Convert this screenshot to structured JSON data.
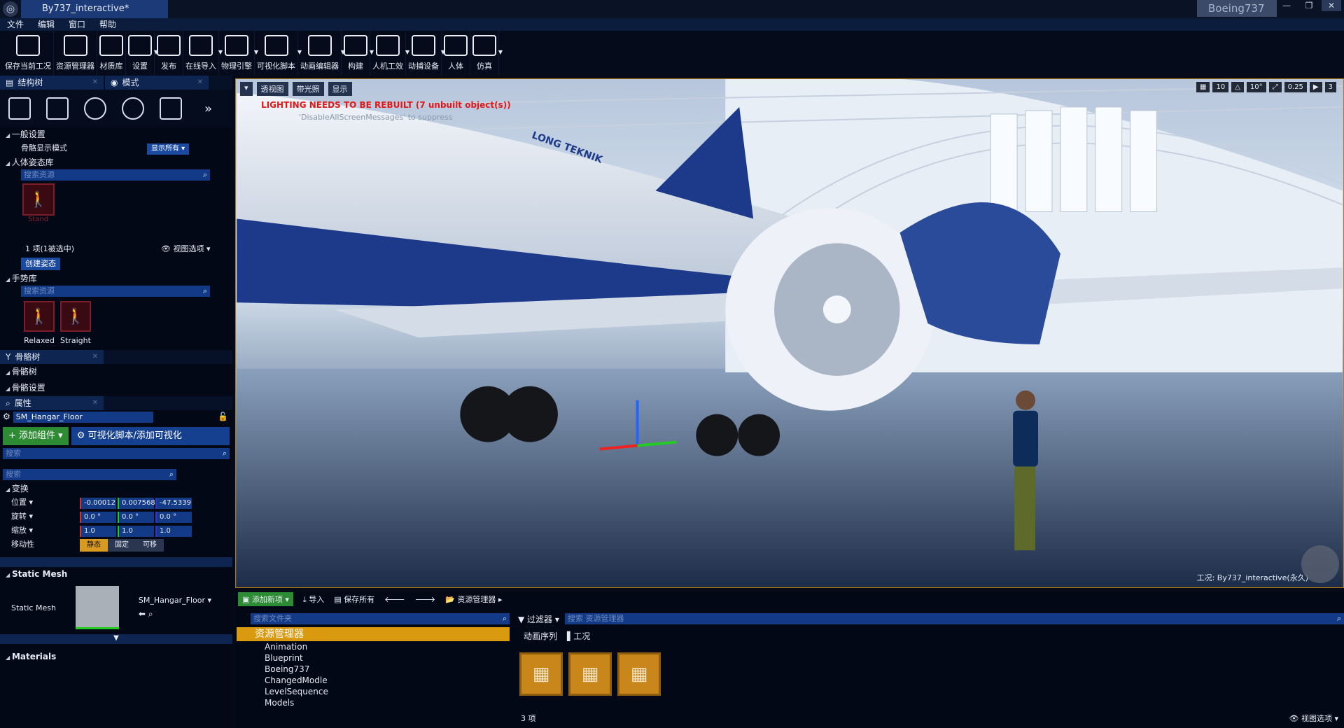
{
  "title": {
    "doc_tab": "By737_interactive*",
    "project": "Boeing737",
    "app_icon": "ue-logo-icon"
  },
  "menu": [
    "文件",
    "编辑",
    "窗口",
    "帮助"
  ],
  "toolbar": [
    {
      "label": "保存当前工况",
      "icon": "save-icon"
    },
    {
      "label": "资源管理器",
      "icon": "content-browser-icon"
    },
    {
      "label": "材质库",
      "icon": "palette-icon"
    },
    {
      "label": "设置",
      "icon": "gear-icon"
    },
    {
      "label": "发布",
      "icon": "package-icon"
    },
    {
      "label": "在线导入",
      "icon": "import-icon"
    },
    {
      "label": "物理引擎",
      "icon": "physics-icon"
    },
    {
      "label": "可视化脚本",
      "icon": "blueprint-icon"
    },
    {
      "label": "动画编辑器",
      "icon": "clapper-icon"
    },
    {
      "label": "构建",
      "icon": "build-icon"
    },
    {
      "label": "人机工效",
      "icon": "ergonomics-icon"
    },
    {
      "label": "动捕设备",
      "icon": "mocap-icon"
    },
    {
      "label": "人体",
      "icon": "human-icon"
    },
    {
      "label": "仿真",
      "icon": "simulation-icon"
    }
  ],
  "left": {
    "tabs": [
      {
        "label": "结构树"
      },
      {
        "label": "模式"
      }
    ],
    "general": {
      "header": "一般设置",
      "skeleton_mode_label": "骨骼显示模式",
      "show_all_btn": "显示所有"
    },
    "pose_lib": {
      "header": "人体姿态库",
      "search_placeholder": "搜索资源",
      "item_label": "Stand",
      "count": "1 项(1被选中)",
      "view_options": "视图选项",
      "create_btn": "创建姿态"
    },
    "gesture_lib": {
      "header": "手势库",
      "search_placeholder": "搜索资源",
      "items": [
        "Relaxed",
        "Straight"
      ]
    },
    "skeleton_tab": "骨骼树",
    "skeleton_tree": "骨骼树",
    "skeleton_settings": "骨骼设置",
    "props_tab": "属性",
    "actor_name": "SM_Hangar_Floor",
    "add_component": "添加组件",
    "blueprint_btn": "可视化脚本/添加可视化",
    "search1": "搜索",
    "search2": "搜索",
    "transform": {
      "header": "变换",
      "location_label": "位置",
      "rotation_label": "旋转",
      "scale_label": "缩放",
      "mobility_label": "移动性",
      "location": [
        "-0.00012",
        "0.007568",
        "-47.5339"
      ],
      "rotation": [
        "0.0 °",
        "0.0 °",
        "0.0 °"
      ],
      "scale": [
        "1.0",
        "1.0",
        "1.0"
      ],
      "mobility": [
        "静态",
        "固定",
        "可移"
      ]
    },
    "static_mesh": {
      "header": "Static Mesh",
      "label": "Static Mesh",
      "value": "SM_Hangar_Floor"
    },
    "materials_header": "Materials"
  },
  "viewport": {
    "perspective": "透视图",
    "lighting": "带光照",
    "show": "显示",
    "warning": "LIGHTING NEEDS TO BE REBUILT (7 unbuilt object(s))",
    "warning_sub": "'DisableAllScreenMessages' to suppress",
    "toolbar_values": [
      "10",
      "10°",
      "0.25",
      "3"
    ],
    "status": "工况:  By737_interactive(永久)",
    "aircraft_text": "LONG TEKNIK"
  },
  "content": {
    "add_new": "添加新项",
    "import": "导入",
    "save_all": "保存所有",
    "path": "资源管理器",
    "folder_search": "搜索文件夹",
    "asset_search": "搜索 资源管理器",
    "filter": "过滤器",
    "root": "资源管理器",
    "folders": [
      "Animation",
      "Blueprint",
      "Boeing737",
      "ChangedModle",
      "LevelSequence",
      "Models"
    ],
    "filter_tags": [
      "动画序列",
      "工况"
    ],
    "count": "3 项",
    "view_options": "视图选项"
  }
}
